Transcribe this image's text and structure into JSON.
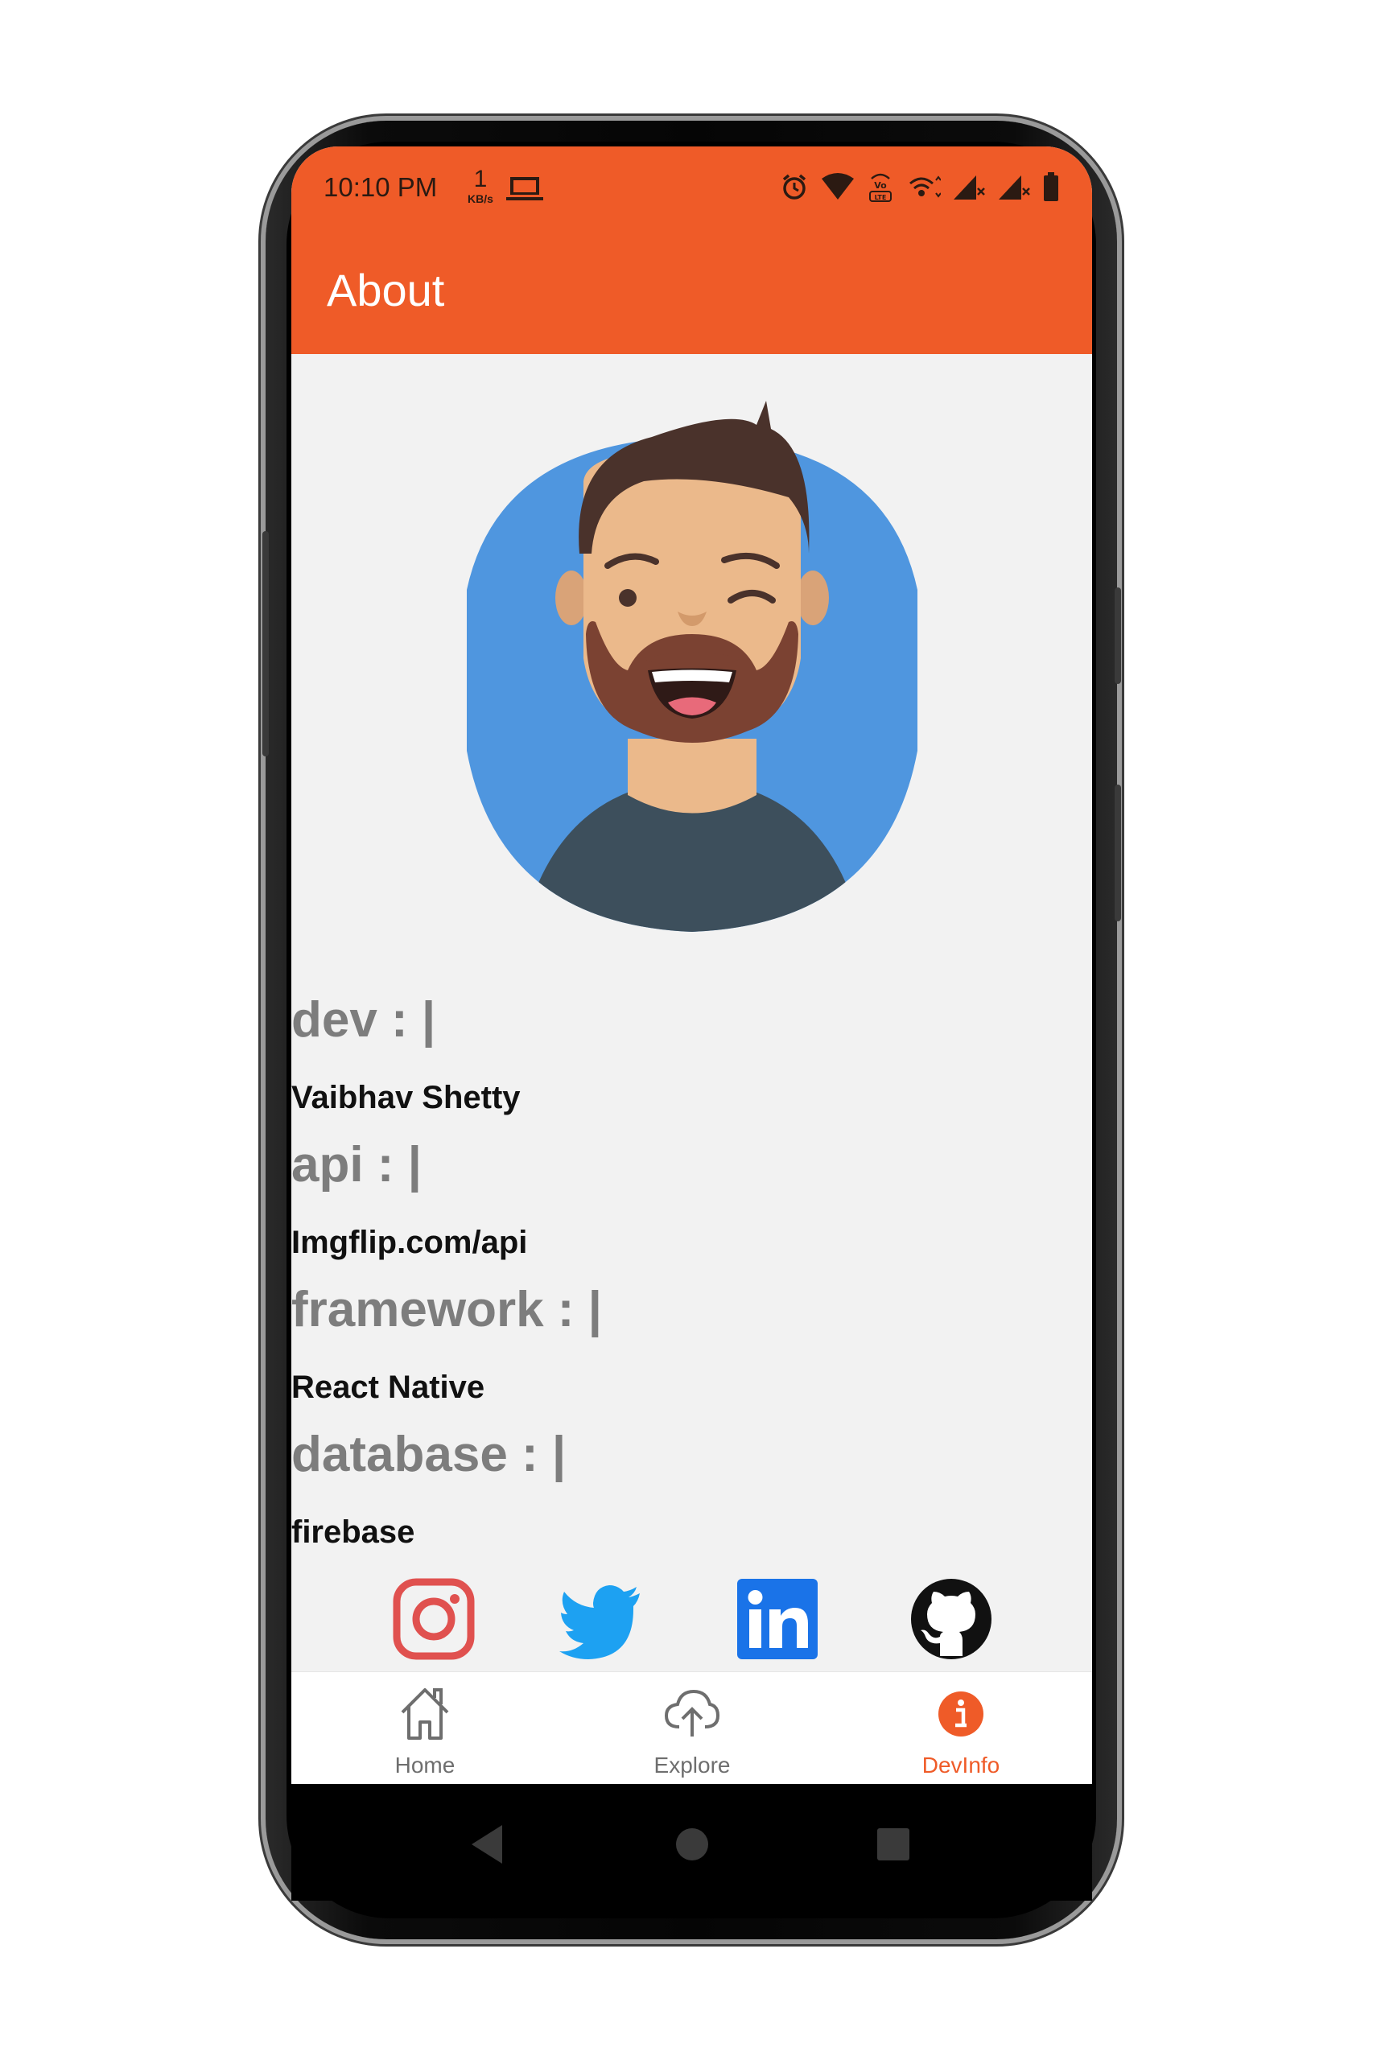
{
  "statusbar": {
    "time": "10:10 PM",
    "net_speed_value": "1",
    "net_speed_unit": "KB/s",
    "icons": [
      "laptop-icon",
      "alarm-icon",
      "wifi-icon",
      "volte-icon",
      "hotspot-icon",
      "signal-icon",
      "signal-icon",
      "battery-icon"
    ]
  },
  "appbar": {
    "title": "About"
  },
  "info": [
    {
      "label": "dev : |",
      "value": "Vaibhav Shetty"
    },
    {
      "label": "api : |",
      "value": "Imgflip.com/api"
    },
    {
      "label": "framework : |",
      "value": "React Native"
    },
    {
      "label": "database : |",
      "value": "firebase"
    }
  ],
  "social": [
    "instagram-icon",
    "twitter-icon",
    "linkedin-icon",
    "github-icon"
  ],
  "bottom_nav": {
    "items": [
      {
        "label": "Home",
        "icon": "home-icon"
      },
      {
        "label": "Explore",
        "icon": "cloud-upload-icon"
      },
      {
        "label": "DevInfo",
        "icon": "info-icon"
      }
    ],
    "active": "DevInfo"
  },
  "colors": {
    "accent": "#ef5b28",
    "background": "#f2f2f2",
    "label_gray": "#7d7d7d"
  },
  "system_nav": [
    "back-icon",
    "home-circle-icon",
    "recents-icon"
  ]
}
